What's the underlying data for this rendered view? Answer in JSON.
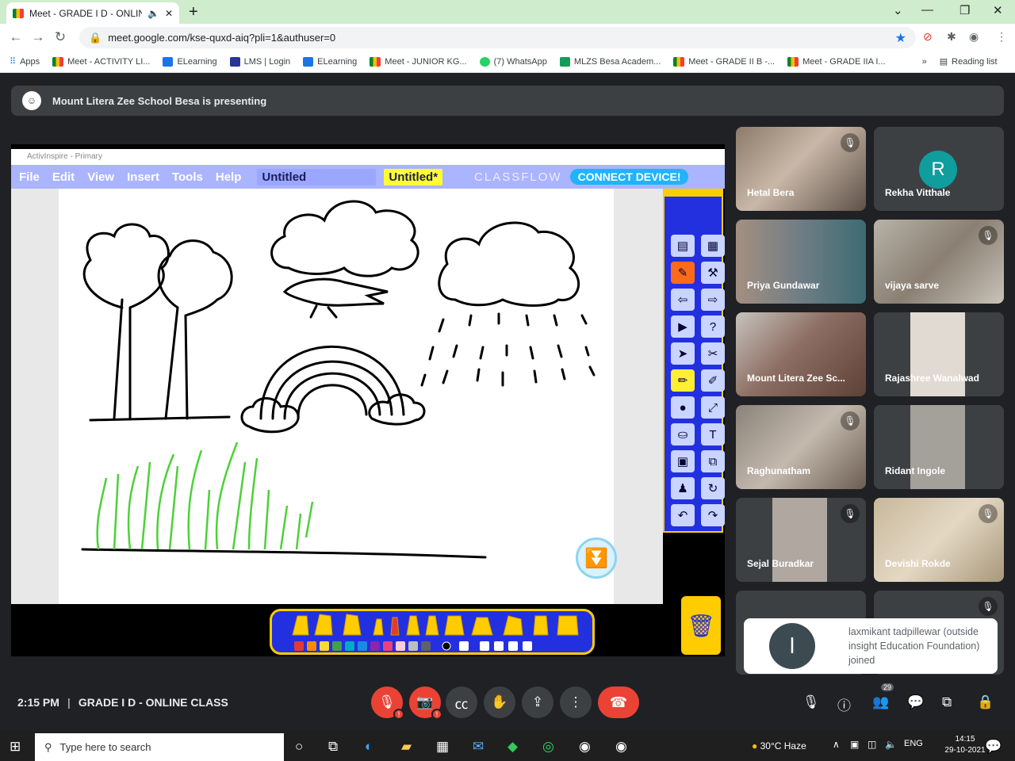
{
  "browser": {
    "tab_title": "Meet - GRADE I D - ONLINE",
    "new_tab": "+",
    "url": "meet.google.com/kse-quxd-aiq?pli=1&authuser=0",
    "bookmarks": [
      {
        "label": "Apps"
      },
      {
        "label": "Meet - ACTIVITY LI..."
      },
      {
        "label": "ELearning"
      },
      {
        "label": "LMS | Login"
      },
      {
        "label": "ELearning"
      },
      {
        "label": "Meet - JUNIOR KG..."
      },
      {
        "label": "(7) WhatsApp"
      },
      {
        "label": "MLZS Besa Academ..."
      },
      {
        "label": "Meet - GRADE II B -..."
      },
      {
        "label": "Meet - GRADE IIA I..."
      }
    ],
    "reading_list": "Reading list",
    "more": "»"
  },
  "presenting": {
    "text": "Mount Litera Zee School Besa is presenting"
  },
  "activinspire": {
    "title": "ActivInspire - Primary",
    "menu": [
      "File",
      "Edit",
      "View",
      "Insert",
      "Tools",
      "Help"
    ],
    "file_tab": "Untitled",
    "file_tab_active": "Untitled*",
    "classflow": "CLASSFLOW",
    "connect": "CONNECT DEVICE!"
  },
  "participants": [
    {
      "name": "Hetal Bera",
      "muted": true
    },
    {
      "name": "Rekha Vitthale",
      "muted": false,
      "initial": "R"
    },
    {
      "name": "Priya Gundawar",
      "muted": false
    },
    {
      "name": "vijaya sarve",
      "muted": true
    },
    {
      "name": "Mount Litera Zee Sc...",
      "muted": false
    },
    {
      "name": "Rajashree Wanalwad",
      "muted": false
    },
    {
      "name": "Raghunatham",
      "muted": true
    },
    {
      "name": "Ridant Ingole",
      "muted": false
    },
    {
      "name": "Sejal Buradkar",
      "muted": true
    },
    {
      "name": "Devishi Rokde",
      "muted": true
    }
  ],
  "toast": {
    "initial": "l",
    "text": "laxmikant tadpillewar (outside insight Education Foundation) joined"
  },
  "meeting": {
    "time": "2:15 PM",
    "separator": "|",
    "name": "GRADE I D - ONLINE CLASS",
    "people_count": "29"
  },
  "taskbar": {
    "search_placeholder": "Type here to search",
    "weather": "30°C  Haze",
    "lang": "ENG",
    "time": "14:15",
    "date": "29-10-2021"
  }
}
